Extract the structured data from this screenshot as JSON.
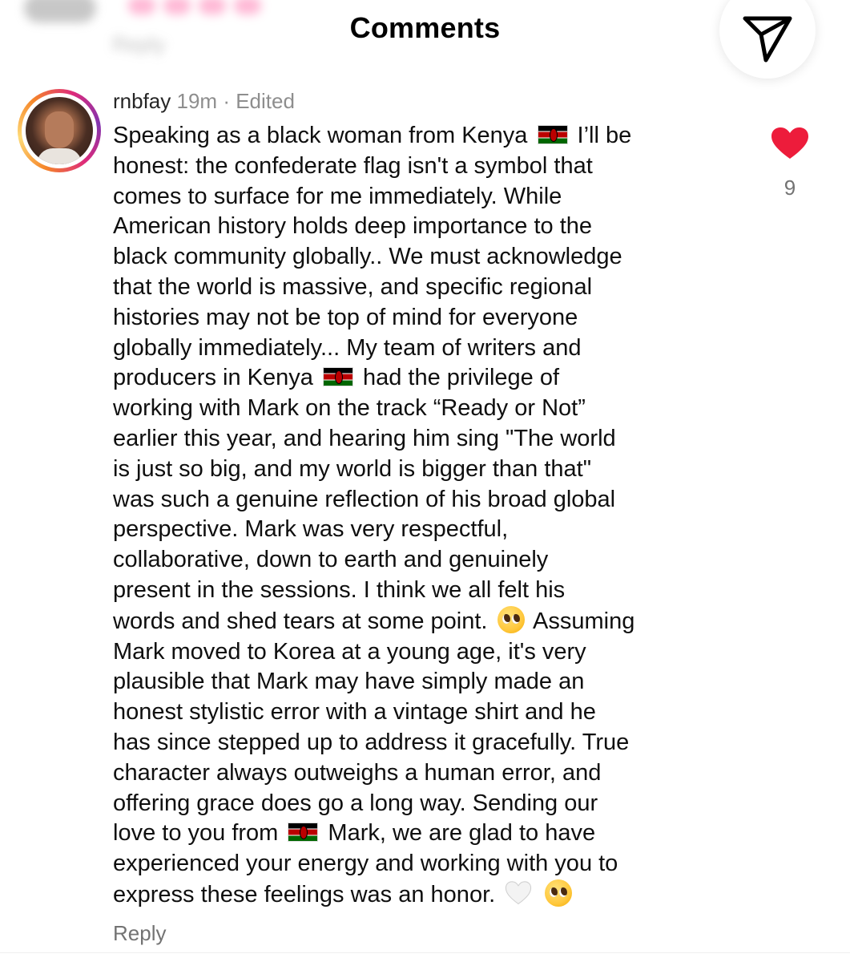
{
  "header": {
    "title": "Comments",
    "share_icon": "send-icon"
  },
  "previous_comment": {
    "reply_label": "Reply"
  },
  "comment": {
    "username": "rnbfay",
    "time": "19m",
    "separator": "·",
    "edited_label": "Edited",
    "like_count": "9",
    "liked": true,
    "like_color": "#ed1c3b",
    "lines": [
      [
        "Speaking as a black woman from Kenya ",
        "flag:ke",
        " I’ll be"
      ],
      [
        "honest: the confederate flag isn't a symbol that"
      ],
      [
        "comes to surface for me immediately. While"
      ],
      [
        "American history holds deep importance to the"
      ],
      [
        "black community globally.. We must acknowledge"
      ],
      [
        "that the world is massive, and specific regional"
      ],
      [
        "histories may not be top of mind for everyone"
      ],
      [
        "globally immediately... My team of writers and"
      ],
      [
        "producers in Kenya ",
        "flag:ke",
        " had the privilege of"
      ],
      [
        "working with Mark on the track “Ready or Not”"
      ],
      [
        "earlier this year, and hearing him sing \"The world"
      ],
      [
        "is just so big, and my world is bigger than that\""
      ],
      [
        "was such a genuine reflection of his broad global"
      ],
      [
        "perspective. Mark was very respectful,"
      ],
      [
        "collaborative, down to earth and genuinely"
      ],
      [
        "present in the sessions. I think we all felt his"
      ],
      [
        "words and shed tears at some point. ",
        "emoji:pleading",
        " Assuming"
      ],
      [
        "Mark moved to Korea at a young age, it's very"
      ],
      [
        "plausible that Mark may have simply made an"
      ],
      [
        "honest stylistic error with a vintage shirt and he"
      ],
      [
        "has since stepped up to address it gracefully. True"
      ],
      [
        "character always outweighs a human error, and"
      ],
      [
        "offering grace does go a long way. Sending our"
      ],
      [
        "love to you from ",
        "flag:ke",
        " Mark, we are glad to have"
      ],
      [
        "experienced your energy and working with you to"
      ],
      [
        "express these feelings was an honor. ",
        "emoji:white-heart",
        " ",
        "emoji:pleading"
      ]
    ],
    "reply_label": "Reply"
  }
}
